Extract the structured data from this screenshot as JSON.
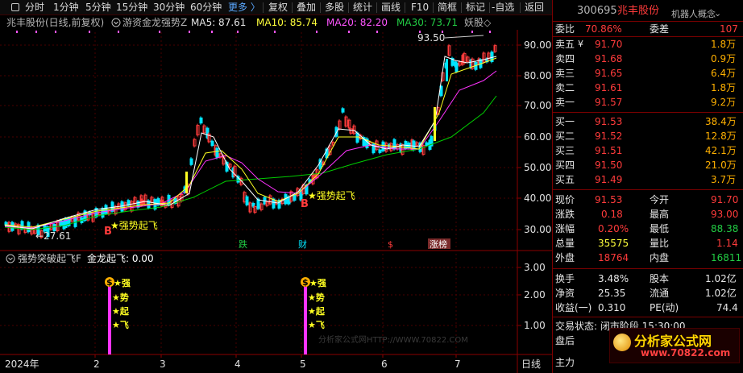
{
  "toolbar": {
    "items": [
      "分时",
      "1分钟",
      "5分钟",
      "15分钟",
      "30分钟",
      "60分钟",
      "更多",
      "复权",
      "叠加",
      "多股",
      "统计",
      "画线",
      "F10",
      "简框",
      "标记",
      "-自选",
      "返回"
    ],
    "more_arrow": "〉"
  },
  "chart_header": {
    "stock_title": "兆丰股份(日线,前复权)",
    "indicator_name": "游资金龙强势Z",
    "ma5": "MA5: 87.61",
    "ma10": "MA10: 85.74",
    "ma20": "MA20: 82.20",
    "ma30": "MA30: 73.71",
    "tag": "妖股◇"
  },
  "main_chart": {
    "type": "line",
    "y_ticks": [
      "90.00",
      "80.00",
      "70.00",
      "60.00",
      "50.00",
      "40.00",
      "30.00"
    ],
    "high_label": "93.50",
    "low_label": "←27.61",
    "signal_labels": [
      "★强势起飞",
      "★强势起飞"
    ],
    "b_markers": [
      "B",
      "B"
    ],
    "event_labels": [
      "跌",
      "财",
      "$",
      "涨榜"
    ],
    "colors": {
      "ma5": "#ffffff",
      "ma10": "#ffff00",
      "ma20": "#ff00ff",
      "ma30": "#00cc00",
      "up": "#ff3b3b",
      "down": "#00e5ff"
    }
  },
  "sub_chart": {
    "title": "强势突破起飞F",
    "value_label": "金龙起飞: 0.00",
    "y_ticks": [
      "3.00",
      "2.00",
      "1.00"
    ],
    "signal_stack": [
      "★强",
      "★势",
      "★起",
      "★飞"
    ],
    "dollar_icon": "$"
  },
  "x_axis": {
    "labels": [
      "2024年",
      "2",
      "3",
      "4",
      "5",
      "6",
      "7"
    ],
    "right_label": "日线"
  },
  "watermark": "分析家公式网HTTP://WWW.70822.COM",
  "panel": {
    "code": "300695",
    "name": "兆丰股份",
    "concept": "机器人概念",
    "weibi_label": "委比",
    "weibi_value": "70.86%",
    "weicha_label": "委差",
    "weicha_value": "107",
    "sell": [
      {
        "label": "卖五",
        "price": "91.70",
        "vol": "1.8万"
      },
      {
        "label": "卖四",
        "price": "91.68",
        "vol": "0.9万"
      },
      {
        "label": "卖三",
        "price": "91.65",
        "vol": "6.4万"
      },
      {
        "label": "卖二",
        "price": "91.61",
        "vol": "1.8万"
      },
      {
        "label": "卖一",
        "price": "91.57",
        "vol": "9.2万"
      }
    ],
    "buy": [
      {
        "label": "买一",
        "price": "91.53",
        "vol": "38.4万"
      },
      {
        "label": "买二",
        "price": "91.52",
        "vol": "12.8万"
      },
      {
        "label": "买三",
        "price": "91.51",
        "vol": "42.1万"
      },
      {
        "label": "买四",
        "price": "91.50",
        "vol": "21.0万"
      },
      {
        "label": "买五",
        "price": "91.49",
        "vol": "3.7万"
      }
    ],
    "quote": [
      {
        "l1": "现价",
        "v1": "91.53",
        "l2": "今开",
        "v2": "91.70"
      },
      {
        "l1": "涨跌",
        "v1": "0.18",
        "l2": "最高",
        "v2": "93.00"
      },
      {
        "l1": "涨幅",
        "v1": "0.20%",
        "l2": "最低",
        "v2": "88.38"
      },
      {
        "l1": "总量",
        "v1": "35575",
        "l2": "量比",
        "v2": "1.14"
      },
      {
        "l1": "外盘",
        "v1": "18764",
        "l2": "内盘",
        "v2": "16811"
      }
    ],
    "stats": [
      {
        "l1": "换手",
        "v1": "3.48%",
        "l2": "股本",
        "v2": "1.02亿"
      },
      {
        "l1": "净资",
        "v1": "25.35",
        "l2": "流通",
        "v2": "1.02亿"
      },
      {
        "l1": "收益(一)",
        "v1": "0.310",
        "l2": "PE(动)",
        "v2": "74.4"
      }
    ],
    "trade_stage": "交易状态: 闭市阶段 15:30:00",
    "after_hours": "盘后",
    "main_force": "主力"
  },
  "logo": {
    "line1": "分析家公式网",
    "line2": "www.70822.com"
  }
}
